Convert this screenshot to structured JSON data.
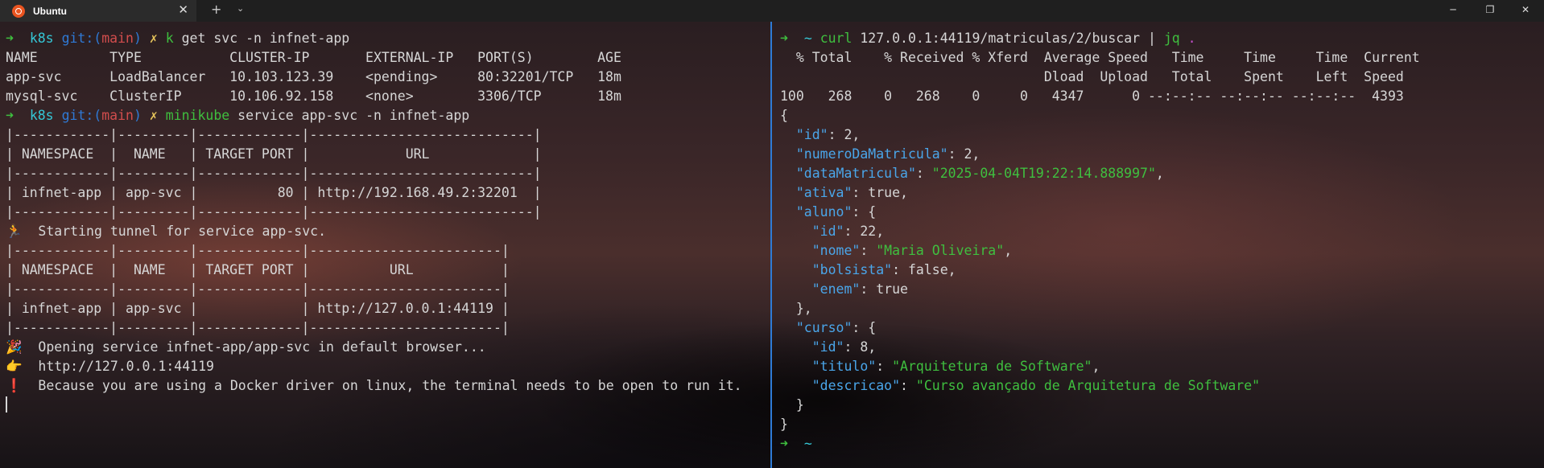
{
  "window": {
    "tab_title": "Ubuntu",
    "tab_close": "✕",
    "new_tab": "+",
    "dropdown": "⌄",
    "minimize": "─",
    "restore": "❐",
    "close": "✕"
  },
  "left": {
    "l1": {
      "arrow": "➜",
      "dir": "k8s",
      "git": "git:(",
      "branch": "main",
      "git_end": ")",
      "x": "✗",
      "cmd": "k",
      "rest": " get svc -n infnet-app"
    },
    "l2": "NAME         TYPE           CLUSTER-IP       EXTERNAL-IP   PORT(S)        AGE",
    "l3": "app-svc      LoadBalancer   10.103.123.39    <pending>     80:32201/TCP   18m",
    "l4": "mysql-svc    ClusterIP      10.106.92.158    <none>        3306/TCP       18m",
    "l5": {
      "arrow": "➜",
      "dir": "k8s",
      "git": "git:(",
      "branch": "main",
      "git_end": ")",
      "x": "✗",
      "cmd": "minikube",
      "rest": " service app-svc -n infnet-app"
    },
    "l6": "|------------|---------|-------------|----------------------------|",
    "l7": "| NAMESPACE  |  NAME   | TARGET PORT |            URL             |",
    "l8": "|------------|---------|-------------|----------------------------|",
    "l9": "| infnet-app | app-svc |          80 | http://192.168.49.2:32201  |",
    "l10": "|------------|---------|-------------|----------------------------|",
    "l11": {
      "emoji": "🏃",
      "text": "  Starting tunnel for service app-svc."
    },
    "l12": "|------------|---------|-------------|------------------------|",
    "l13": "| NAMESPACE  |  NAME   | TARGET PORT |          URL           |",
    "l14": "|------------|---------|-------------|------------------------|",
    "l15": "| infnet-app | app-svc |             | http://127.0.0.1:44119 |",
    "l16": "|------------|---------|-------------|------------------------|",
    "l17": {
      "emoji": "🎉",
      "text": "  Opening service infnet-app/app-svc in default browser..."
    },
    "l18": {
      "emoji": "👉",
      "text": "  http://127.0.0.1:44119"
    },
    "l19": {
      "emoji": "❗",
      "text": "  Because you are using a Docker driver on linux, the terminal needs to be open to run it."
    }
  },
  "right": {
    "r1": {
      "arrow": "➜",
      "dir": "~",
      "cmd": "curl",
      "rest": " 127.0.0.1:44119/matriculas/2/buscar | ",
      "jq": "jq",
      "dot": "."
    },
    "r2": "  % Total    % Received % Xferd  Average Speed   Time     Time     Time  Current",
    "r3": "                                 Dload  Upload   Total    Spent    Left  Speed",
    "r4": "100   268    0   268    0     0   4347      0 --:--:-- --:--:-- --:--:--  4393",
    "json": {
      "open": "{",
      "id_k": "\"id\"",
      "id_v": ": 2,",
      "num_k": "\"numeroDaMatricula\"",
      "num_v": ": 2,",
      "data_k": "\"dataMatricula\"",
      "data_s": "\"2025-04-04T19:22:14.888997\"",
      "ativa_k": "\"ativa\"",
      "ativa_v": ": true,",
      "aluno_k": "\"aluno\"",
      "aluno_v": ": {",
      "aid_k": "\"id\"",
      "aid_v": ": 22,",
      "nome_k": "\"nome\"",
      "nome_s": "\"Maria Oliveira\"",
      "bolsa_k": "\"bolsista\"",
      "bolsa_v": ": false,",
      "enem_k": "\"enem\"",
      "enem_v": ": true",
      "close_aluno": "},",
      "curso_k": "\"curso\"",
      "curso_v": ": {",
      "cid_k": "\"id\"",
      "cid_v": ": 8,",
      "tit_k": "\"titulo\"",
      "tit_s": "\"Arquitetura de Software\"",
      "desc_k": "\"descricao\"",
      "desc_s": "\"Curso avançado de Arquitetura de Software\"",
      "close_curso": "}",
      "close": "}"
    },
    "r_prompt": {
      "arrow": "➜",
      "dir": "~"
    }
  }
}
